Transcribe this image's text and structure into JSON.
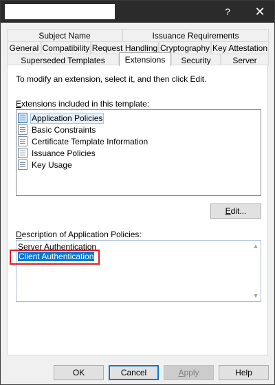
{
  "titlebar": {
    "help_glyph": "?",
    "close_glyph": "✕"
  },
  "tabs_row1": [
    {
      "label": "Subject Name"
    },
    {
      "label": "Issuance Requirements"
    }
  ],
  "tabs_row2": [
    {
      "label": "General"
    },
    {
      "label": "Compatibility"
    },
    {
      "label": "Request Handling"
    },
    {
      "label": "Cryptography"
    },
    {
      "label": "Key Attestation"
    }
  ],
  "tabs_row3": [
    {
      "label": "Superseded Templates"
    },
    {
      "label": "Extensions",
      "active": true
    },
    {
      "label": "Security"
    },
    {
      "label": "Server"
    }
  ],
  "panel": {
    "instruction": "To modify an extension, select it, and then click Edit.",
    "extensions_label_accel": "E",
    "extensions_label_rest": "xtensions included in this template:",
    "extensions": [
      {
        "label": "Application Policies",
        "selected": true
      },
      {
        "label": "Basic Constraints"
      },
      {
        "label": "Certificate Template Information"
      },
      {
        "label": "Issuance Policies"
      },
      {
        "label": "Key Usage"
      }
    ],
    "edit_button_accel": "E",
    "edit_button_rest": "dit...",
    "description_label_accel": "D",
    "description_label_rest": "escription of Application Policies:",
    "description_lines": [
      {
        "text": "Server Authentication"
      },
      {
        "text": "Client Authentication",
        "selected": true
      }
    ]
  },
  "footer": {
    "ok": "OK",
    "cancel": "Cancel",
    "apply_accel": "A",
    "apply_rest": "pply",
    "help": "Help"
  },
  "colors": {
    "accent": "#0078d7",
    "highlight": "#e01b24",
    "titlebar": "#2b2b2b"
  }
}
